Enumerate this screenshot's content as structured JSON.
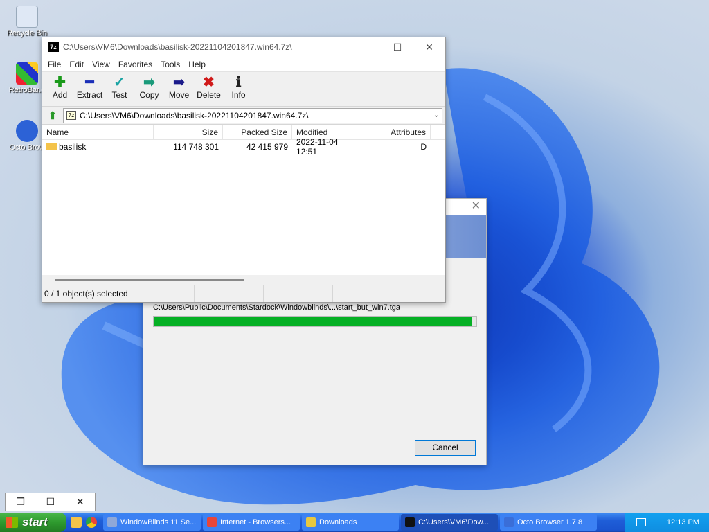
{
  "desktop": {
    "icons": [
      {
        "label": "Recycle Bin"
      },
      {
        "label": "RetroBar.e"
      },
      {
        "label": "Octo Brow"
      }
    ]
  },
  "window7z": {
    "title": "C:\\Users\\VM6\\Downloads\\basilisk-20221104201847.win64.7z\\",
    "app_icon": "7z",
    "menu": [
      "File",
      "Edit",
      "View",
      "Favorites",
      "Tools",
      "Help"
    ],
    "toolbar": [
      {
        "label": "Add",
        "icon": "plus-icon",
        "glyph": "✚",
        "color": "#1a9a1a"
      },
      {
        "label": "Extract",
        "icon": "minus-icon",
        "glyph": "━",
        "color": "#1a2fb8"
      },
      {
        "label": "Test",
        "icon": "check-icon",
        "glyph": "✓",
        "color": "#1aa3a3"
      },
      {
        "label": "Copy",
        "icon": "copy-arrow-icon",
        "glyph": "➡",
        "color": "#1a9a7a"
      },
      {
        "label": "Move",
        "icon": "move-arrow-icon",
        "glyph": "➡",
        "color": "#1a1a8a"
      },
      {
        "label": "Delete",
        "icon": "delete-x-icon",
        "glyph": "✖",
        "color": "#d01a1a"
      },
      {
        "label": "Info",
        "icon": "info-icon",
        "glyph": "ℹ",
        "color": "#222222"
      }
    ],
    "address": "C:\\Users\\VM6\\Downloads\\basilisk-20221104201847.win64.7z\\",
    "columns": {
      "name": "Name",
      "size": "Size",
      "packed": "Packed Size",
      "modified": "Modified",
      "attributes": "Attributes"
    },
    "rows": [
      {
        "name": "basilisk",
        "size": "114 748 301",
        "packed": "42 415 979",
        "modified": "2022-11-04 12:51",
        "attributes": "D"
      }
    ],
    "status": "0 / 1 object(s) selected"
  },
  "progress_dialog": {
    "file": "C:\\Users\\Public\\Documents\\Stardock\\Windowblinds\\...\\start_but_win7.tga",
    "progress": 0.99,
    "cancel_label": "Cancel"
  },
  "taskbar": {
    "start_label": "start",
    "tasks": [
      {
        "label": "WindowBlinds 11 Se...",
        "color": "#8fa8d8",
        "active": false
      },
      {
        "label": "Internet - Browsers...",
        "color": "#e8463a",
        "active": false
      },
      {
        "label": "Downloads",
        "color": "#e8c840",
        "active": false
      },
      {
        "label": "C:\\Users\\VM6\\Dow...",
        "color": "#111111",
        "active": true
      },
      {
        "label": "Octo Browser 1.7.8",
        "color": "#3a6ed8",
        "active": false
      }
    ],
    "clock": "12:13 PM"
  }
}
